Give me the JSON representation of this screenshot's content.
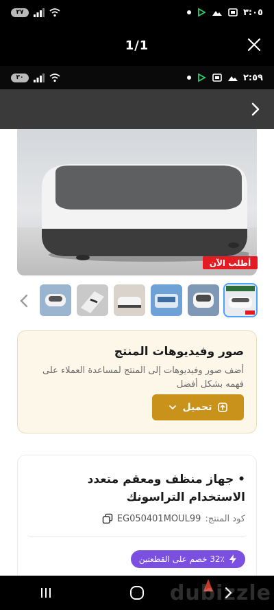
{
  "outer_status": {
    "time": "٣:٠٥",
    "battery": "٢٧"
  },
  "viewer": {
    "counter": "1/1"
  },
  "inner_status": {
    "time": "٢:٥٩",
    "battery": "٣٠"
  },
  "hero": {
    "order_now": "أطلب الآن"
  },
  "thumbnails": [
    {
      "name": "thumb-1"
    },
    {
      "name": "thumb-2"
    },
    {
      "name": "thumb-3"
    },
    {
      "name": "thumb-4"
    },
    {
      "name": "thumb-5"
    },
    {
      "name": "thumb-6"
    }
  ],
  "upload": {
    "title": "صور وفيديوهات المنتج",
    "description": "أضف صور وفيديوهات إلى المنتج لمساعدة العملاء على فهمه بشكل أفضل",
    "button_label": "تحميل"
  },
  "product": {
    "title": "• جهاز منظف ومعقم متعدد الاستخدام التراسونك",
    "code_label": "كود المنتج:",
    "code_value": "EG050401MOUL99",
    "discount": "32٪ خصم على القطعتين"
  },
  "watermark": "dubizzle",
  "colors": {
    "accent": "#c8921b",
    "discount": "#7b4fe0",
    "order_badge": "#e31b23",
    "header": "#3a3a3a"
  }
}
